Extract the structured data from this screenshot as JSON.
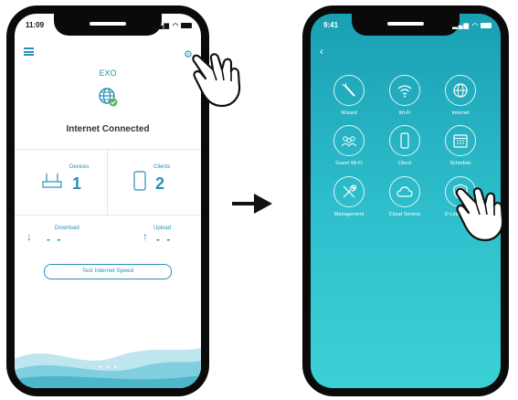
{
  "phone1": {
    "status_time": "11:09",
    "device_name": "EXO",
    "connection_status": "Internet Connected",
    "devices": {
      "label": "Devices",
      "value": "1"
    },
    "clients": {
      "label": "Clients",
      "value": "2"
    },
    "download": {
      "label": "Download",
      "value": "- -"
    },
    "upload": {
      "label": "Upload",
      "value": "- -"
    },
    "test_button": "Test Internet Speed"
  },
  "phone2": {
    "status_time": "9:41",
    "tiles": [
      {
        "label": "Wizard",
        "icon": "wand-icon"
      },
      {
        "label": "Wi-Fi",
        "icon": "wifi-icon"
      },
      {
        "label": "Internet",
        "icon": "globe-icon"
      },
      {
        "label": "Guest Wi-Fi",
        "icon": "guest-wifi-icon"
      },
      {
        "label": "Client",
        "icon": "phone-icon"
      },
      {
        "label": "Schedule",
        "icon": "calendar-icon"
      },
      {
        "label": "Management",
        "icon": "tools-icon"
      },
      {
        "label": "Cloud Service",
        "icon": "cloud-icon"
      },
      {
        "label": "D-Link defend",
        "icon": "shield-icon"
      }
    ]
  },
  "colors": {
    "accent": "#2a8fb8",
    "teal_bg": "#2fc0cd",
    "frame": "#0a0a0a"
  }
}
